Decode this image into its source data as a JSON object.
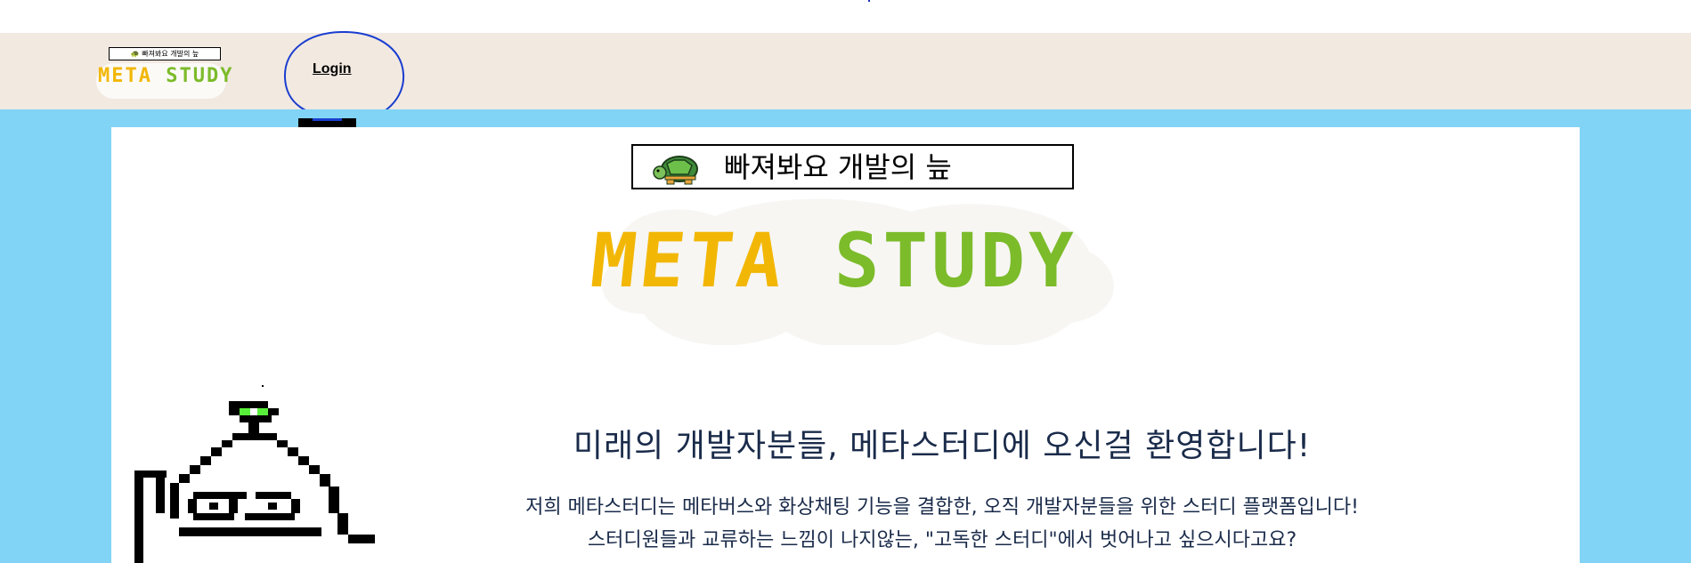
{
  "header": {
    "logo_tagline": "빠져봐요 개발의 늪",
    "logo_word_meta": "META",
    "logo_word_study": "STUDY",
    "login_label": "Login"
  },
  "hero": {
    "tagline": "빠져봐요 개발의 늪",
    "logo_word_meta": "META",
    "logo_word_study": "STUDY"
  },
  "welcome": {
    "title": "미래의 개발자분들, 메타스터디에 오신걸 환영합니다!",
    "line1": "저희 메타스터디는 메타버스와 화상채팅 기능을 결합한, 오직 개발자분들을 위한 스터디 플랫폼입니다!",
    "line2": "스터디원들과 교류하는 느낌이 나지않는, \"고독한 스터디\"에서 벗어나고 싶으시다고요?"
  },
  "colors": {
    "header_bg": "#f2e9e1",
    "page_bg": "#81d4f5",
    "meta_yellow": "#f2b705",
    "study_green": "#7cbb2a",
    "annotation_blue": "#1a3ecf"
  },
  "icons": {
    "turtle": "turtle-icon",
    "mascot": "pixel-sprout-mascot"
  }
}
